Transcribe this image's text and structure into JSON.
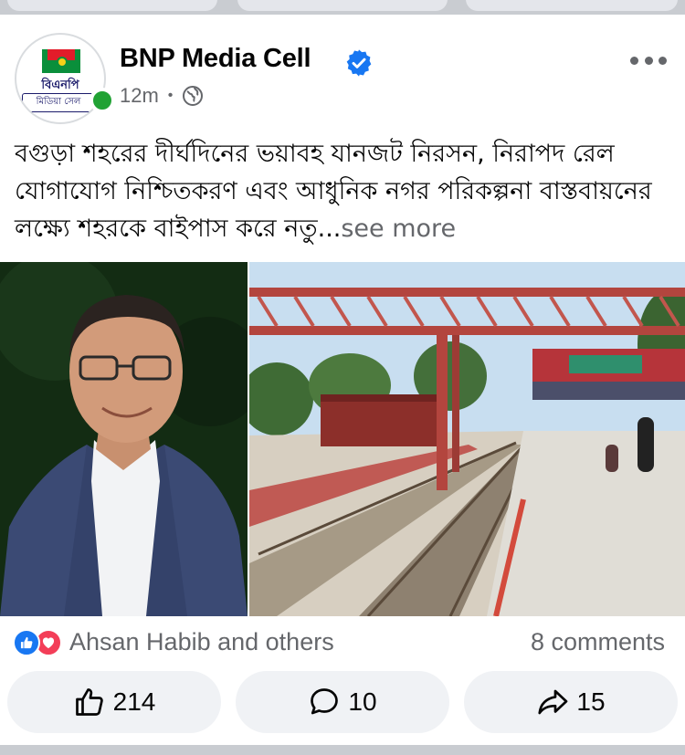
{
  "post": {
    "page_name": "BNP Media Cell",
    "time": "12m",
    "separator": "•",
    "logo": {
      "line1": "বিএনপি",
      "line2": "মিডিয়া সেল"
    },
    "text_main": "বগুড়া শহরের দীর্ঘদিনের ভয়াবহ যানজট নিরসন, নিরাপদ রেল যোগাযোগ নিশ্চিতকরণ এবং আধুনিক নগর পরিকল্পনা বাস্তবায়নের লক্ষ্যে শহরকে বাইপাস করে নতু...",
    "see_more": "see more",
    "photos": [
      "portrait-photo",
      "railway-station-photo"
    ]
  },
  "engagement": {
    "reaction_names": "Ahsan Habib and others",
    "comments": "8 comments"
  },
  "actions": {
    "like_count": "214",
    "comment_count": "10",
    "share_count": "15"
  },
  "colors": {
    "brand_blue": "#1877f2",
    "secondary_text": "#65676b",
    "online_green": "#21a234",
    "love_red": "#f33e58"
  },
  "icons": [
    "verified-icon",
    "globe-icon",
    "more-icon",
    "like-reaction-icon",
    "love-reaction-icon",
    "thumbs-up-icon",
    "comment-icon",
    "share-icon"
  ]
}
